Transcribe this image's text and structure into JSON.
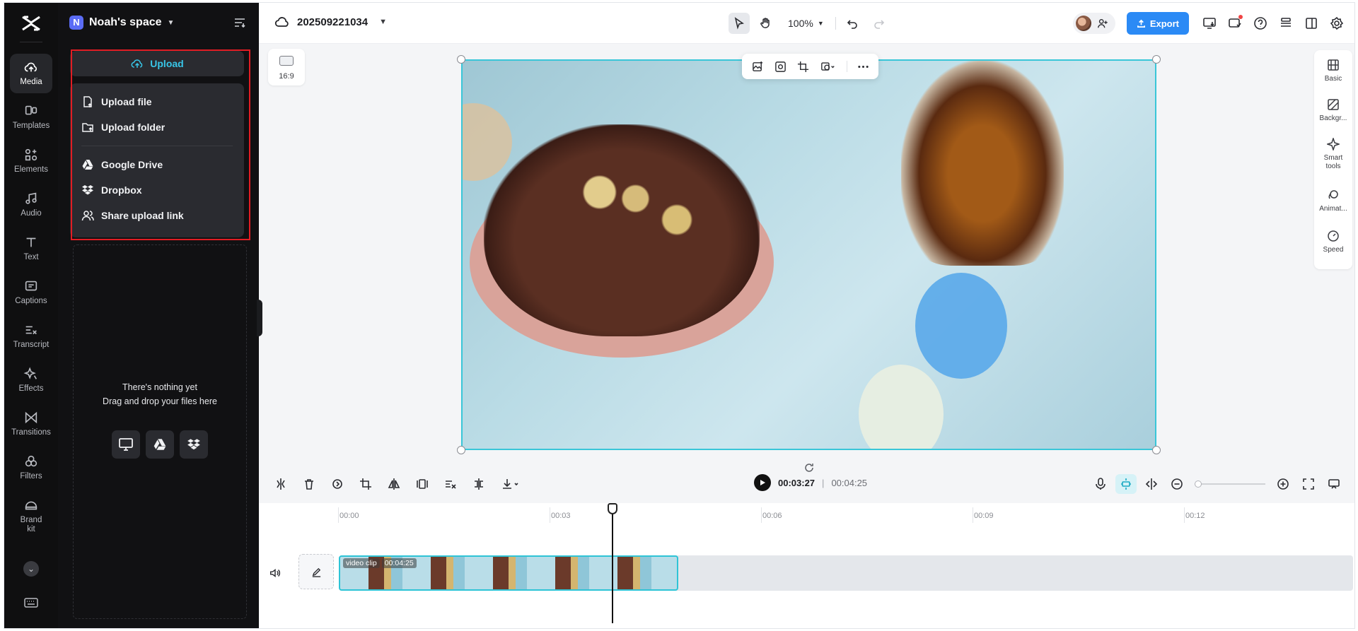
{
  "workspace": {
    "initial": "N",
    "name": "Noah's space"
  },
  "rail": {
    "items": [
      {
        "label": "Media"
      },
      {
        "label": "Templates"
      },
      {
        "label": "Elements"
      },
      {
        "label": "Audio"
      },
      {
        "label": "Text"
      },
      {
        "label": "Captions"
      },
      {
        "label": "Transcript"
      },
      {
        "label": "Effects"
      },
      {
        "label": "Transitions"
      },
      {
        "label": "Filters"
      },
      {
        "label": "Brand kit"
      }
    ],
    "active": "Media"
  },
  "panel": {
    "upload_label": "Upload",
    "menu": [
      "Upload file",
      "Upload folder",
      "Google Drive",
      "Dropbox",
      "Share upload link"
    ],
    "empty_title": "There's nothing yet",
    "empty_subtitle": "Drag and drop your files here"
  },
  "topbar": {
    "project_name": "202509221034",
    "zoom": "100%",
    "export_label": "Export"
  },
  "canvas": {
    "aspect_ratio": "16:9",
    "accent": "#39c6d8"
  },
  "right_panel": {
    "items": [
      {
        "label": "Basic"
      },
      {
        "label": "Backgr..."
      },
      {
        "label": "Smart tools"
      },
      {
        "label": "Animat..."
      },
      {
        "label": "Speed"
      }
    ]
  },
  "timeline": {
    "current_time": "00:03:27",
    "total_time": "00:04:25",
    "ticks": [
      "00:00",
      "00:03",
      "00:06",
      "00:09",
      "00:12"
    ],
    "clip": {
      "name": "video clip",
      "duration": "00:04:25"
    }
  },
  "colors": {
    "brand_blue": "#2b8af5",
    "highlight_red": "#e11d24",
    "cyan": "#38c6e8"
  }
}
